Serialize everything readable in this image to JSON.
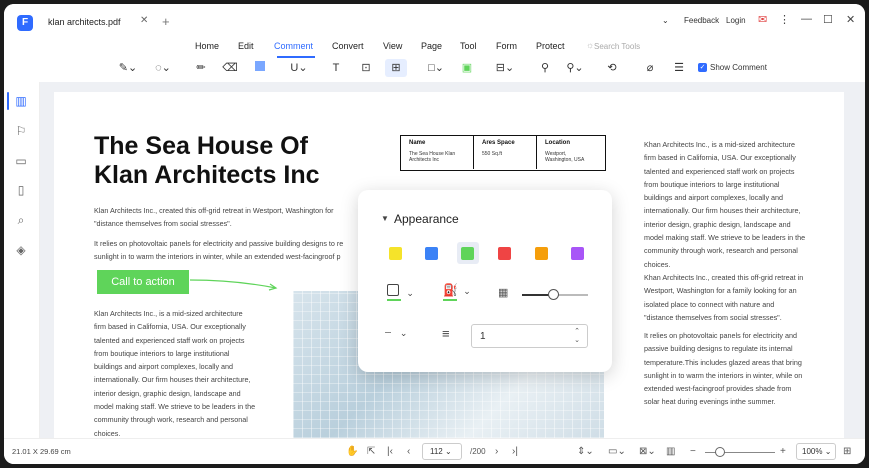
{
  "app": {
    "logo_glyph": "F"
  },
  "tab": {
    "title": "klan architects.pdf",
    "close": "✕",
    "new_tab": "+"
  },
  "titlebar": {
    "feedback": "Feedback",
    "login": "Login",
    "chevron": "⌄",
    "minimize": "—",
    "maximize": "☐",
    "close": "✕",
    "more": "⋮"
  },
  "menu": {
    "items": [
      "Home",
      "Edit",
      "Comment",
      "Convert",
      "View",
      "Page",
      "Tool",
      "Form",
      "Protect"
    ],
    "active": "Comment",
    "search_placeholder": "Search Tools"
  },
  "toolbar": {
    "show_comment": "Show Comment",
    "show_comment_checked": true
  },
  "document": {
    "title_line1": "The Sea House Of",
    "title_line2": "Klan Architects Inc",
    "para1_l1": "Klan Architects Inc., created this off-grid retreat in Westport, Washington for",
    "para1_l2": "\"distance themselves from social stresses\".",
    "para2_l1": "It relies on photovoltaic panels for electricity and passive building designs to re",
    "para2_l2": "sunlight in to warm the interiors in winter, while an extended west-facingroof p",
    "call_to_action": "Call to action",
    "left_para": [
      "Klan Architects Inc., is a mid-sized architecture",
      "firm based in California, USA. Our exceptionally",
      "talented and experienced staff work on projects",
      "from boutique interiors to large institutional",
      "buildings and airport complexes, locally and",
      "internationally. Our firm houses their architecture,",
      "interior design, graphic design, landscape and",
      "model making staff. We strieve to be leaders in the",
      "community through work, research and personal",
      "choices."
    ],
    "table": {
      "name_h": "Name",
      "name_v1": "The Sea House Klan",
      "name_v2": "Architects Inc",
      "area_h": "Ares Space",
      "area_v1": "550 Sq.ft",
      "loc_h": "Location",
      "loc_v1": "Westport,",
      "loc_v2": "Washington, USA"
    },
    "right_para1": [
      "Khan Architects Inc., is a mid-sized architecture",
      "firm based in California, USA. Our exceptionally",
      "talented and experienced staff work on projects",
      "from boutique interiors to large institutional",
      "buildings and airport complexes, locally and",
      "internationally. Our firm houses their architecture,",
      "interior design, graphic design, landscape and",
      "model making staff. We strieve to be leaders in the",
      "community through work, research and personal",
      "choices."
    ],
    "right_para2": [
      "Khan Architects Inc., created this off-grid retreat in",
      "Westport, Washington for a family looking for an",
      "isolated place to connect with nature and",
      "\"distance themselves from social stresses\"."
    ],
    "right_para3": [
      "It relies on photovoltaic panels for electricity and",
      "passive building designs to regulate its internal",
      "temperature.This includes glazed areas that bring",
      "sunlight in to warm the interiors in winter, while on",
      "extended west-facingroof provides shade from",
      "solar heat during evenings inthe summer."
    ]
  },
  "appearance_popup": {
    "title": "Appearance",
    "caret": "▼",
    "swatches": [
      "#f5e32a",
      "#3b82f6",
      "#5fd45a",
      "#ef4444",
      "#f59e0b",
      "#a855f7"
    ],
    "selected_swatch_index": 2,
    "border_color": "#5fd45a",
    "fill_color": "#5fd45a",
    "opacity_level": 0.5,
    "line_width_value": "1",
    "chevron": "⌄",
    "up_arrow": "⌃",
    "down_arrow": "⌄"
  },
  "statusbar": {
    "dimensions": "21.01 X 29.69 cm",
    "page_current": "112",
    "page_total": "/200",
    "zoom": "100%",
    "zoom_level": 0.15
  },
  "colors": {
    "accent": "#2f6bff",
    "cta_green": "#5fd45a"
  }
}
